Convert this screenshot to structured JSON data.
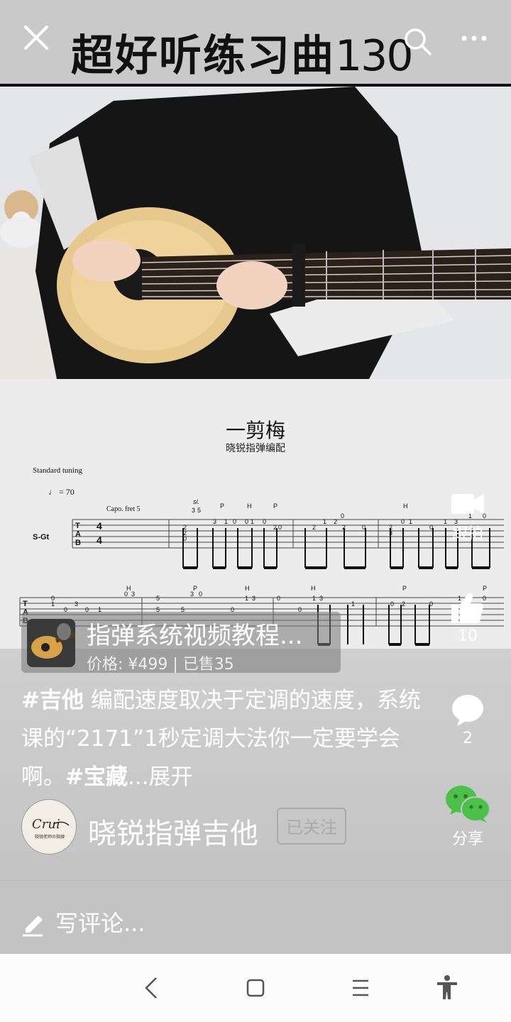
{
  "header": {
    "title_text": "超好听练习曲",
    "title_num": "130"
  },
  "sheet": {
    "title": "一剪梅",
    "subtitle": "晓锐指弹编配",
    "tuning": "Standard tuning",
    "tempo": "♩ = 70",
    "capo": "Capo. fret 5",
    "track": "S-Gt"
  },
  "product": {
    "title": "指弹系统视频教程...",
    "price": "价格: ¥499 | 已售35"
  },
  "caption": {
    "tag1": "#吉他",
    "text1": " 编配速度取决于定调的速度，系统课的“2171”1秒定调大法你一定要学会啊。",
    "tag2": "#宝藏",
    "more": "...展开"
  },
  "author": {
    "name": "晓锐指弹吉他",
    "follow_label": "已关注",
    "avatar_text": "Crui",
    "avatar_sub": "晓锐老师の指弹"
  },
  "actions": {
    "record_label": "跟拍",
    "like_count": "10",
    "comment_count": "2",
    "share_label": "分享"
  },
  "comment": {
    "placeholder": "写评论..."
  },
  "colors": {
    "wechat_green": "#4cc14a"
  }
}
